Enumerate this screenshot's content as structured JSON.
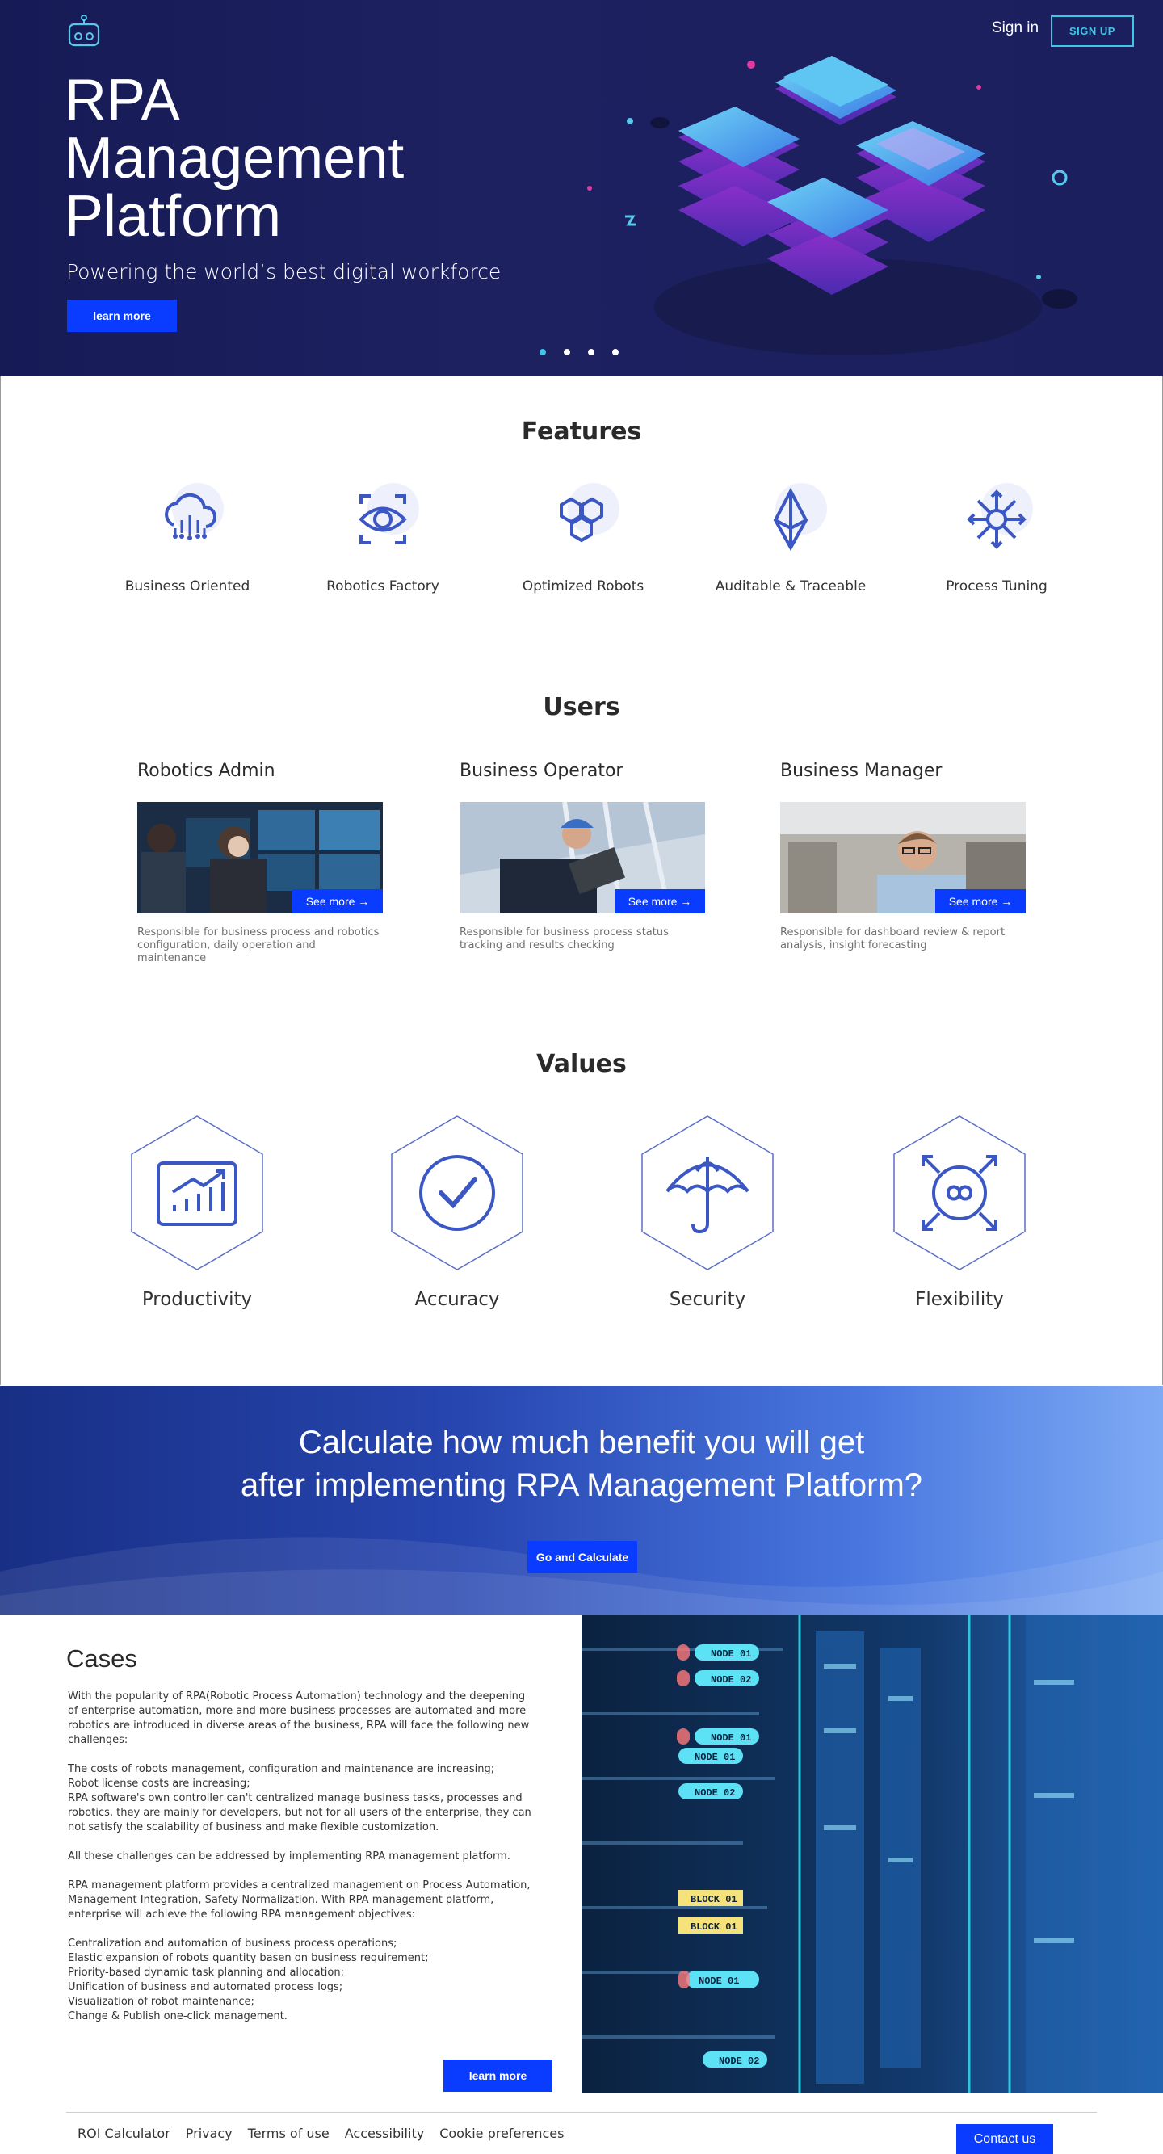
{
  "header": {
    "logo_icon": "robot-logo-icon",
    "signin_label": "Sign in",
    "signup_label": "SIGN UP"
  },
  "hero": {
    "title": "RPA Management Platform",
    "subtitle": "Powering the world’s best digital workforce",
    "button_label": "learn more",
    "carousel_dots": 4,
    "active_dot": 0
  },
  "features": {
    "title": "Features",
    "items": [
      {
        "label": "Business Oriented",
        "icon": "cloud-network-icon"
      },
      {
        "label": "Robotics Factory",
        "icon": "eye-scan-icon"
      },
      {
        "label": "Optimized Robots",
        "icon": "hexagon-cluster-icon"
      },
      {
        "label": "Auditable & Traceable",
        "icon": "ethereum-diamond-icon"
      },
      {
        "label": "Process Tuning",
        "icon": "hub-arrows-icon"
      }
    ]
  },
  "users": {
    "title": "Users",
    "see_more": "See more →",
    "items": [
      {
        "name": "Robotics Admin",
        "desc": "Responsible for business process and robotics configuration, daily operation and maintenance"
      },
      {
        "name": "Business Operator",
        "desc": "Responsible for business process status tracking and results checking"
      },
      {
        "name": "Business Manager",
        "desc": "Responsible for dashboard review & report analysis, insight forecasting"
      }
    ]
  },
  "values": {
    "title": "Values",
    "items": [
      {
        "label": "Productivity",
        "icon": "growth-chart-icon"
      },
      {
        "label": "Accuracy",
        "icon": "check-circle-icon"
      },
      {
        "label": "Security",
        "icon": "umbrella-icon"
      },
      {
        "label": "Flexibility",
        "icon": "infinity-arrows-icon"
      }
    ]
  },
  "calculator": {
    "title_line1": "Calculate how much benefit you will get",
    "title_line2": "after implementing RPA Management Platform?",
    "button_label": "Go and Calculate"
  },
  "cases": {
    "title": "Cases",
    "paragraphs": [
      "With the popularity of RPA(Robotic Process Automation) technology and the deepening of enterprise automation, more and more business processes are automated and more robotics are introduced in diverse areas of the business, RPA will face the following new challenges:",
      "The costs of robots management, configuration and maintenance are increasing;\nRobot license costs are increasing;\nRPA software's own controller can't centralized manage business tasks, processes and robotics, they are mainly for developers, but not for all users of the enterprise, they can not satisfy the scalability of business and make flexible customization.",
      "All these challenges can be addressed by implementing RPA management platform.",
      "RPA management platform provides a centralized management on Process Automation, Management Integration, Safety Normalization. With RPA management platform, enterprise will achieve the following RPA management objectives:",
      "Centralization and automation of business process operations;\nElastic expansion of robots quantity basen on business requirement;\nPriority-based dynamic task planning and allocation;\nUnification of business and automated process logs;\nVisualization of robot maintenance;\nChange & Publish one-click management."
    ],
    "button_label": "learn more",
    "image_labels": [
      "NODE 01",
      "NODE 02",
      "NODE 01",
      "NODE 01",
      "NODE 02",
      "BLOCK 01",
      "BLOCK 01",
      "NODE 01",
      "NODE 02"
    ]
  },
  "footer": {
    "links": [
      "ROI Calculator",
      "Privacy",
      "Terms of use",
      "Accessibility",
      "Cookie preferences"
    ],
    "contact_label": "Contact us"
  },
  "colors": {
    "hero_bg": "#1b1f5e",
    "accent_blue": "#0a3cff",
    "cyan": "#3fc6e6",
    "icon_blue": "#3b57c4"
  }
}
